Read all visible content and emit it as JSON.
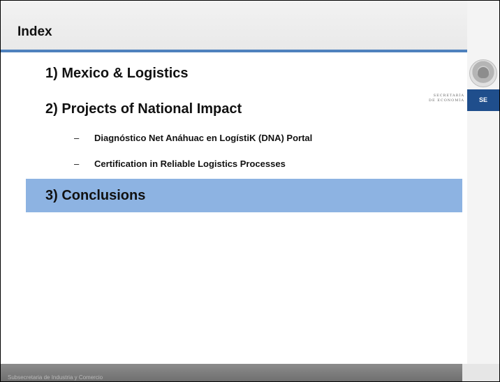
{
  "slide": {
    "title": "Index",
    "items": [
      {
        "label": "1)  Mexico & Logistics"
      },
      {
        "label": "2)  Projects of National Impact"
      },
      {
        "dash": "–",
        "label": "Diagnóstico Net Anáhuac en LogístiK (DNA) Portal"
      },
      {
        "dash": "–",
        "label": "Certification in Reliable Logistics Processes"
      },
      {
        "label": "3)  Conclusions"
      }
    ],
    "logo": {
      "secretaria": "SECRETARÍA",
      "economia": "DE ECONOMÍA",
      "badge": "SE"
    },
    "footer": "Subsecretaria de Industria y Comercio"
  },
  "colors": {
    "accent": "#4f81bd",
    "highlight": "#8db3e2",
    "badge": "#1f4e8c"
  }
}
